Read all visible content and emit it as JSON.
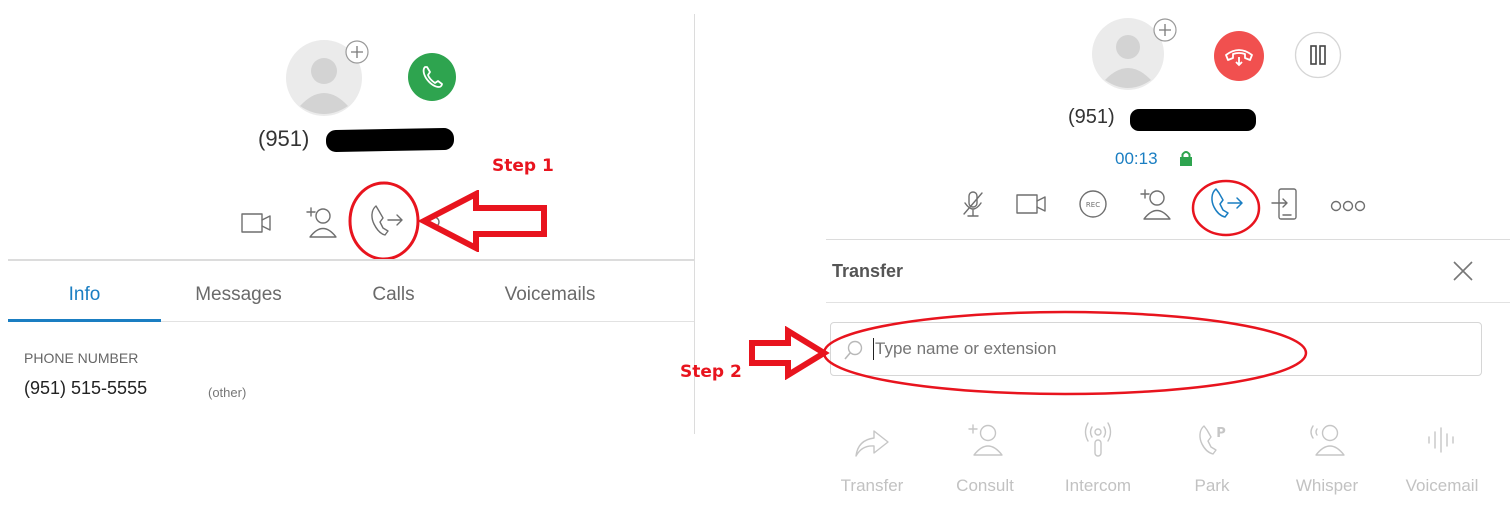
{
  "left_panel": {
    "phone_display": "(951) ",
    "tabs": [
      {
        "label": "Info",
        "active": true
      },
      {
        "label": "Messages",
        "active": false
      },
      {
        "label": "Calls",
        "active": false
      },
      {
        "label": "Voicemails",
        "active": false
      }
    ],
    "info": {
      "section_label": "PHONE NUMBER",
      "phone_number": "(951) 515-5555",
      "phone_type": "(other)"
    }
  },
  "right_panel": {
    "phone_display": "(951) ",
    "call_timer": "00:13",
    "transfer": {
      "title": "Transfer",
      "search_placeholder": "Type name or extension",
      "actions": [
        {
          "label": "Transfer",
          "icon": "forward-arrow-icon"
        },
        {
          "label": "Consult",
          "icon": "add-person-icon"
        },
        {
          "label": "Intercom",
          "icon": "intercom-icon"
        },
        {
          "label": "Park",
          "icon": "park-icon"
        },
        {
          "label": "Whisper",
          "icon": "whisper-icon"
        },
        {
          "label": "Voicemail",
          "icon": "voicemail-icon"
        }
      ]
    }
  },
  "annotations": {
    "step1": "Step 1",
    "step2": "Step 2"
  },
  "colors": {
    "accent_blue": "#1a7ec2",
    "call_green": "#2ea44f",
    "hangup_red": "#f1504f",
    "annotation_red": "#e8141e",
    "lock_green": "#2ea44f"
  }
}
